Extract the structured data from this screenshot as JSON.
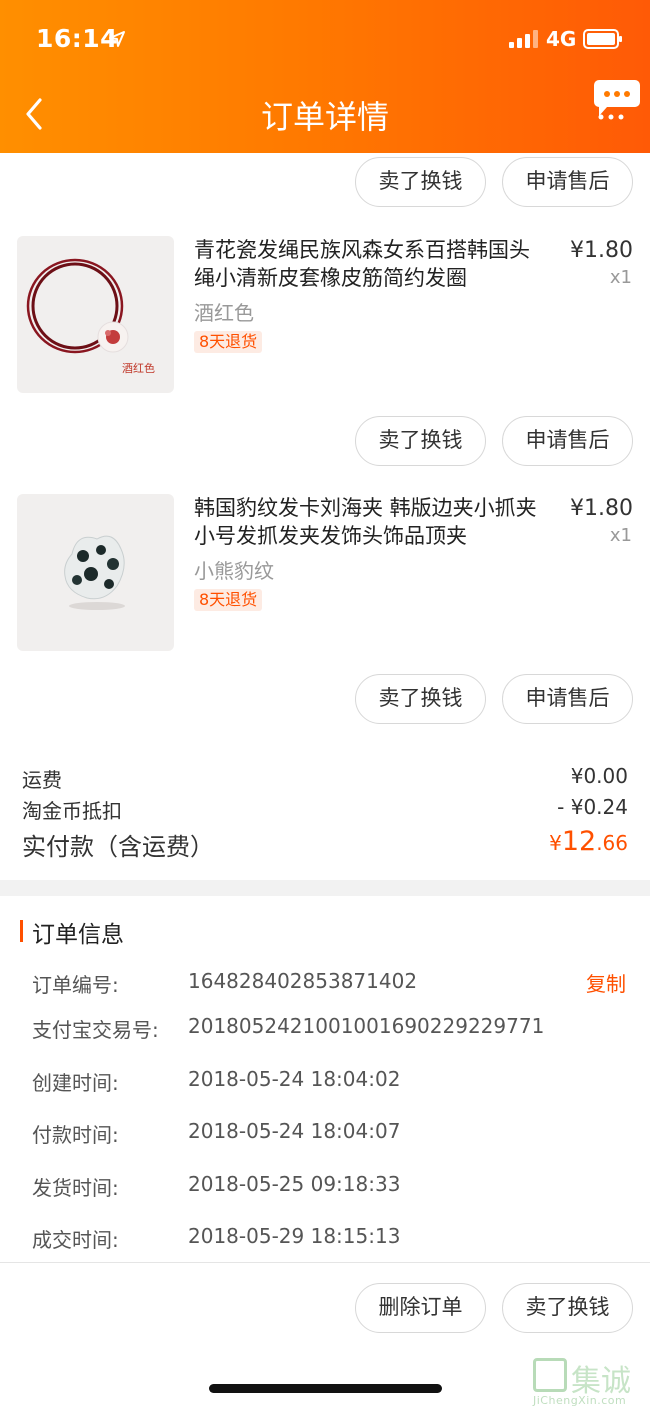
{
  "status_bar": {
    "time": "16:14",
    "network": "4G"
  },
  "header": {
    "title": "订单详情"
  },
  "products": [
    {
      "title": "青花瓷发绳民族风森女系百搭韩国头绳小清新皮套橡皮筋简约发圈",
      "price": "¥1.80",
      "qty": "x1",
      "sku": "酒红色",
      "tag": "8天退货",
      "image_label": "酒红色",
      "btn_sell": "卖了换钱",
      "btn_after_sale": "申请售后"
    },
    {
      "title": "韩国豹纹发卡刘海夹 韩版边夹小抓夹 小号发抓发夹发饰头饰品顶夹",
      "price": "¥1.80",
      "qty": "x1",
      "sku": "小熊豹纹",
      "tag": "8天退货",
      "btn_sell": "卖了换钱",
      "btn_after_sale": "申请售后"
    }
  ],
  "top_buttons": {
    "sell": "卖了换钱",
    "after_sale": "申请售后"
  },
  "summary": {
    "shipping_label": "运费",
    "shipping_value": "¥0.00",
    "coin_label": "淘金币抵扣",
    "coin_value": "- ¥0.24",
    "total_label": "实付款（含运费）",
    "total_currency": "¥",
    "total_int": "12",
    "total_dec": ".66"
  },
  "order_info": {
    "title": "订单信息",
    "copy_label": "复制",
    "rows": [
      {
        "label": "订单编号:",
        "value": "164828402853871402"
      },
      {
        "label": "支付宝交易号:",
        "value": "2018052421001001690229229771"
      },
      {
        "label": "创建时间:",
        "value": "2018-05-24 18:04:02"
      },
      {
        "label": "付款时间:",
        "value": "2018-05-24 18:04:07"
      },
      {
        "label": "发货时间:",
        "value": "2018-05-25 09:18:33"
      },
      {
        "label": "成交时间:",
        "value": "2018-05-29 18:15:13"
      }
    ]
  },
  "footer_buttons": {
    "delete": "删除订单",
    "sell": "卖了换钱"
  },
  "watermark": {
    "text": "集诚信",
    "sub": "JiChengXin.com"
  },
  "colors": {
    "accent": "#ff5000",
    "header_start": "#ff8f00",
    "header_end": "#ff5a06"
  }
}
